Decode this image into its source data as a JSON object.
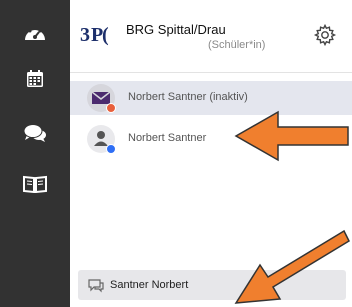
{
  "sidebar": {
    "items": [
      {
        "name": "dashboard-icon"
      },
      {
        "name": "calendar-icon"
      },
      {
        "name": "chat-icon"
      },
      {
        "name": "book-icon"
      }
    ],
    "background": "#323232"
  },
  "header": {
    "school_name": "BRG Spittal/Drau",
    "role": "(Schüler*in)"
  },
  "contacts": [
    {
      "label": "Norbert Santner (inaktiv)",
      "status_color": "#e8603c",
      "selected": true
    },
    {
      "label": "Norbert Santner",
      "status_color": "#2e6ef5",
      "selected": false
    }
  ],
  "bottom": {
    "label": "Santner Norbert"
  },
  "annotations": {
    "arrow_color": "#f07f2e"
  }
}
